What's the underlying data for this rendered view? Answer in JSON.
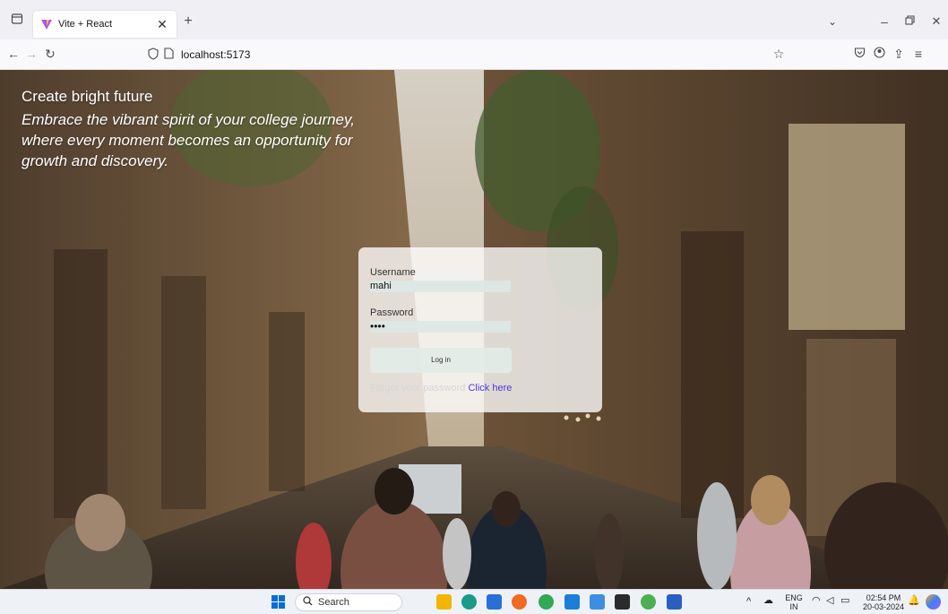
{
  "browser": {
    "tab": {
      "title": "Vite + React"
    },
    "new_tab": "+",
    "url": "localhost:5173",
    "window_controls": {
      "minimize": "–",
      "restore": "🗗",
      "close": "✕"
    }
  },
  "page": {
    "hero": {
      "heading": "Create bright future",
      "tagline": "Embrace the vibrant spirit of your college journey, where every moment becomes an opportunity for growth and discovery."
    },
    "login": {
      "username_label": "Username",
      "username_value": "mahi",
      "password_label": "Password",
      "password_value": "••••",
      "login_button": "Log in",
      "forgot_text": "Forgot your password",
      "forgot_link": "Click here"
    }
  },
  "taskbar": {
    "search_placeholder": "Search",
    "language": {
      "line1": "ENG",
      "line2": "IN"
    },
    "time": "02:54 PM",
    "date": "20-03-2024"
  },
  "colors": {
    "link": "#4a3ad8",
    "titlebar": "#f0f0f4",
    "taskbar": "#eef1f6"
  }
}
